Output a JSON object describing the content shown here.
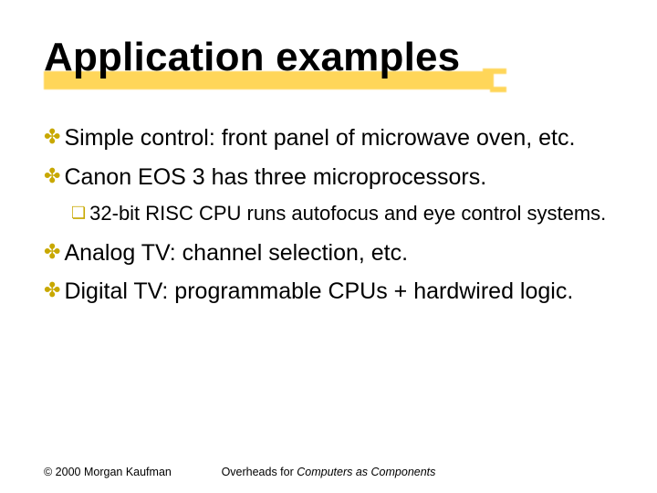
{
  "title": "Application examples",
  "bullets": {
    "b1": "Simple control: front panel of microwave oven, etc.",
    "b2": "Canon EOS 3 has three microprocessors.",
    "b2a": "32-bit RISC CPU runs autofocus and eye control systems.",
    "b3": "Analog TV: channel selection, etc.",
    "b4": "Digital TV: programmable CPUs + hardwired logic."
  },
  "footer": {
    "copyright": "© 2000 Morgan Kaufman",
    "center_prefix": "Overheads for ",
    "center_italic": "Computers as Components"
  },
  "glyphs": {
    "z": "✤",
    "y": "❏"
  }
}
